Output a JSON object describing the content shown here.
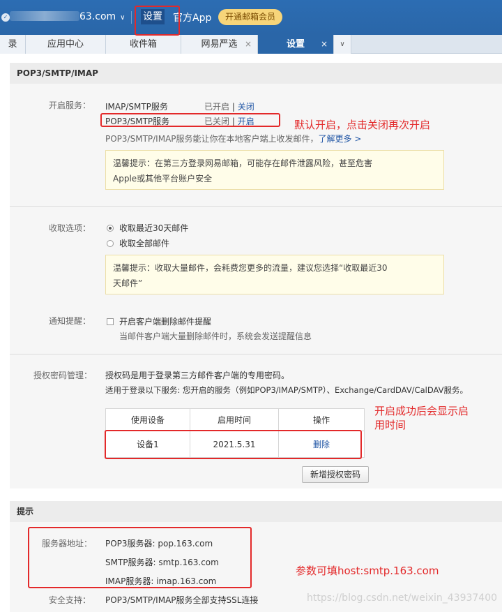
{
  "topbar": {
    "account_suffix": "63.com",
    "settings_label": "设置",
    "app_label": "官方App",
    "vip_label": "开通邮箱会员"
  },
  "tabs": [
    {
      "label": "录",
      "closable": false,
      "active": false
    },
    {
      "label": "应用中心",
      "closable": false,
      "active": false
    },
    {
      "label": "收件箱",
      "closable": false,
      "active": false
    },
    {
      "label": "网易严选",
      "closable": true,
      "active": false
    },
    {
      "label": "设置",
      "closable": true,
      "active": true
    }
  ],
  "section_pop": {
    "title": "POP3/SMTP/IMAP",
    "service_label": "开启服务：",
    "services": [
      {
        "name": "IMAP/SMTP服务",
        "status": "已开启",
        "action": "关闭"
      },
      {
        "name": "POP3/SMTP服务",
        "status": "已关闭",
        "action": "开启"
      }
    ],
    "description": "POP3/SMTP/IMAP服务能让你在本地客户端上收发邮件，",
    "learn_more": "了解更多 >",
    "tip1_line1": "温馨提示：在第三方登录网易邮箱，可能存在邮件泄露风险，甚至危害",
    "tip1_line2": "Apple或其他平台账户安全",
    "fetch_label": "收取选项：",
    "fetch_options": [
      {
        "label": "收取最近30天邮件",
        "checked": true
      },
      {
        "label": "收取全部邮件",
        "checked": false
      }
    ],
    "tip2_line1": "温馨提示：收取大量邮件，会耗费您更多的流量，建议您选择“收取最近30",
    "tip2_line2": "天邮件”",
    "notify_label": "通知提醒：",
    "notify_option": "开启客户端删除邮件提醒",
    "notify_hint": "当邮件客户端大量删除邮件时，系统会发送提醒信息",
    "auth_label": "授权密码管理：",
    "auth_desc1": "授权码是用于登录第三方邮件客户端的专用密码。",
    "auth_desc2": "适用于登录以下服务: 您开启的服务（例如POP3/IMAP/SMTP）、Exchange/CardDAV/CalDAV服务。",
    "table_headers": [
      "使用设备",
      "启用时间",
      "操作"
    ],
    "table_rows": [
      {
        "device": "设备1",
        "time": "2021.5.31",
        "action": "删除"
      }
    ],
    "new_auth_button": "新增授权密码"
  },
  "section_tips": {
    "title": "提示",
    "server_label": "服务器地址：",
    "servers": [
      "POP3服务器: pop.163.com",
      "SMTP服务器: smtp.163.com",
      "IMAP服务器: imap.163.com"
    ],
    "ssl_label": "安全支持：",
    "ssl_value": "POP3/SMTP/IMAP服务全部支持SSL连接"
  },
  "annotations": {
    "note1": "默认开启，点击关闭再次开启",
    "note2_line1": "开启成功后会显示启",
    "note2_line2": "用时间",
    "note3": "参数可填host:smtp.163.com"
  },
  "watermark": "https://blog.csdn.net/weixin_43937400",
  "colors": {
    "topbar": "#2a66a8",
    "link": "#2156a5",
    "annotation_red": "#e3292a",
    "tip_bg": "#fffde9"
  }
}
